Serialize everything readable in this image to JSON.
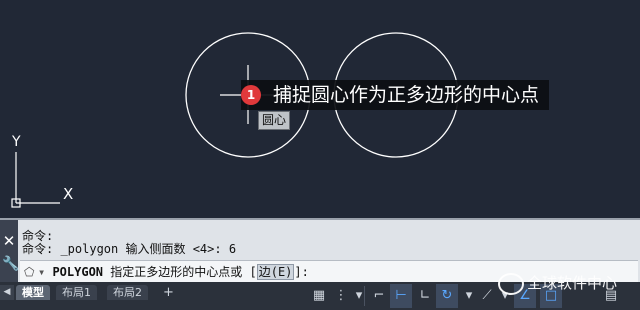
{
  "canvas": {
    "annotation_number": "1",
    "annotation_text": "捕捉圆心作为正多边形的中心点",
    "snap_tooltip": "圆心",
    "ucs_y": "Y",
    "ucs_x": "X"
  },
  "command": {
    "history": [
      "命令:",
      "命令: _polygon 输入侧面数 <4>: 6"
    ],
    "prompt_icon": "polygon-icon",
    "prompt_name": "POLYGON",
    "prompt_text": " 指定正多边形的中心点或 [",
    "prompt_option": "边(E)",
    "prompt_end": "]:"
  },
  "layout_tabs": [
    "模型",
    "布局1",
    "布局2"
  ],
  "add_tab": "+",
  "watermark": "全球软件中心"
}
